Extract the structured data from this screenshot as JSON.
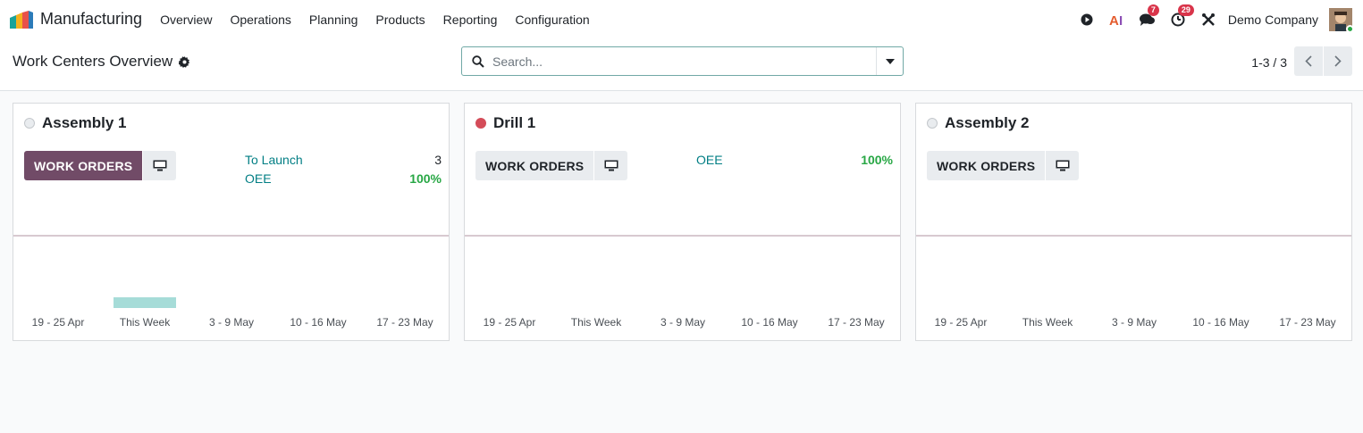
{
  "navbar": {
    "app_name": "Manufacturing",
    "menu": [
      "Overview",
      "Operations",
      "Planning",
      "Products",
      "Reporting",
      "Configuration"
    ],
    "messages_count": "7",
    "activities_count": "29",
    "company": "Demo Company",
    "icons": [
      "play-circle-icon",
      "ai-icon",
      "chat-bubbles-icon",
      "clock-icon",
      "tools-icon"
    ]
  },
  "control_panel": {
    "title": "Work Centers Overview",
    "search_placeholder": "Search...",
    "pager": "1-3 / 3"
  },
  "cards": [
    {
      "name": "Assembly 1",
      "status": "grey",
      "button_label": "WORK ORDERS",
      "button_style": "primary",
      "stats": [
        {
          "label": "To Launch",
          "value": "3"
        },
        {
          "label": "OEE",
          "value": "100%"
        }
      ]
    },
    {
      "name": "Drill 1",
      "status": "red",
      "button_label": "WORK ORDERS",
      "button_style": "secondary",
      "stats": [
        {
          "label": "OEE",
          "value": "100%"
        }
      ]
    },
    {
      "name": "Assembly 2",
      "status": "grey",
      "button_label": "WORK ORDERS",
      "button_style": "secondary",
      "stats": []
    }
  ],
  "chart_data": [
    {
      "type": "bar",
      "categories": [
        "19 - 25 Apr",
        "This Week",
        "3 - 9 May",
        "10 - 16 May",
        "17 - 23 May"
      ],
      "values": [
        0,
        1,
        0,
        0,
        0
      ]
    },
    {
      "type": "bar",
      "categories": [
        "19 - 25 Apr",
        "This Week",
        "3 - 9 May",
        "10 - 16 May",
        "17 - 23 May"
      ],
      "values": [
        0,
        0,
        0,
        0,
        0
      ]
    },
    {
      "type": "bar",
      "categories": [
        "19 - 25 Apr",
        "This Week",
        "3 - 9 May",
        "10 - 16 May",
        "17 - 23 May"
      ],
      "values": [
        0,
        0,
        0,
        0,
        0
      ]
    }
  ],
  "colors": {
    "primary": "#714b67",
    "link": "#017e84",
    "success": "#28a745",
    "danger": "#d44c59",
    "bar": "#a6dcd8"
  }
}
